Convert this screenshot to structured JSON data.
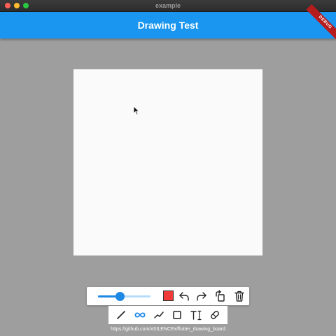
{
  "window": {
    "title": "example"
  },
  "appbar": {
    "title": "Drawing Test",
    "debug_banner": "DEBUG",
    "color": "#1a96f0"
  },
  "toolbar": {
    "stroke_width_fraction": 0.42,
    "selected_color": "#f03a3a",
    "actions": [
      {
        "name": "undo",
        "icon": "undo-icon"
      },
      {
        "name": "redo",
        "icon": "redo-icon"
      },
      {
        "name": "rotate",
        "icon": "rotate-icon"
      },
      {
        "name": "clear",
        "icon": "trash-icon"
      }
    ],
    "tools": [
      {
        "name": "line",
        "icon": "pen-line-icon"
      },
      {
        "name": "smooth-line",
        "icon": "infinity-icon",
        "selected": true
      },
      {
        "name": "straight-line",
        "icon": "polyline-icon"
      },
      {
        "name": "rectangle",
        "icon": "square-icon"
      },
      {
        "name": "text",
        "icon": "text-icon"
      },
      {
        "name": "eraser",
        "icon": "eraser-icon"
      }
    ]
  },
  "footer": {
    "link": "https://github.com/xSILENCEx/flutter_drawing_board"
  }
}
